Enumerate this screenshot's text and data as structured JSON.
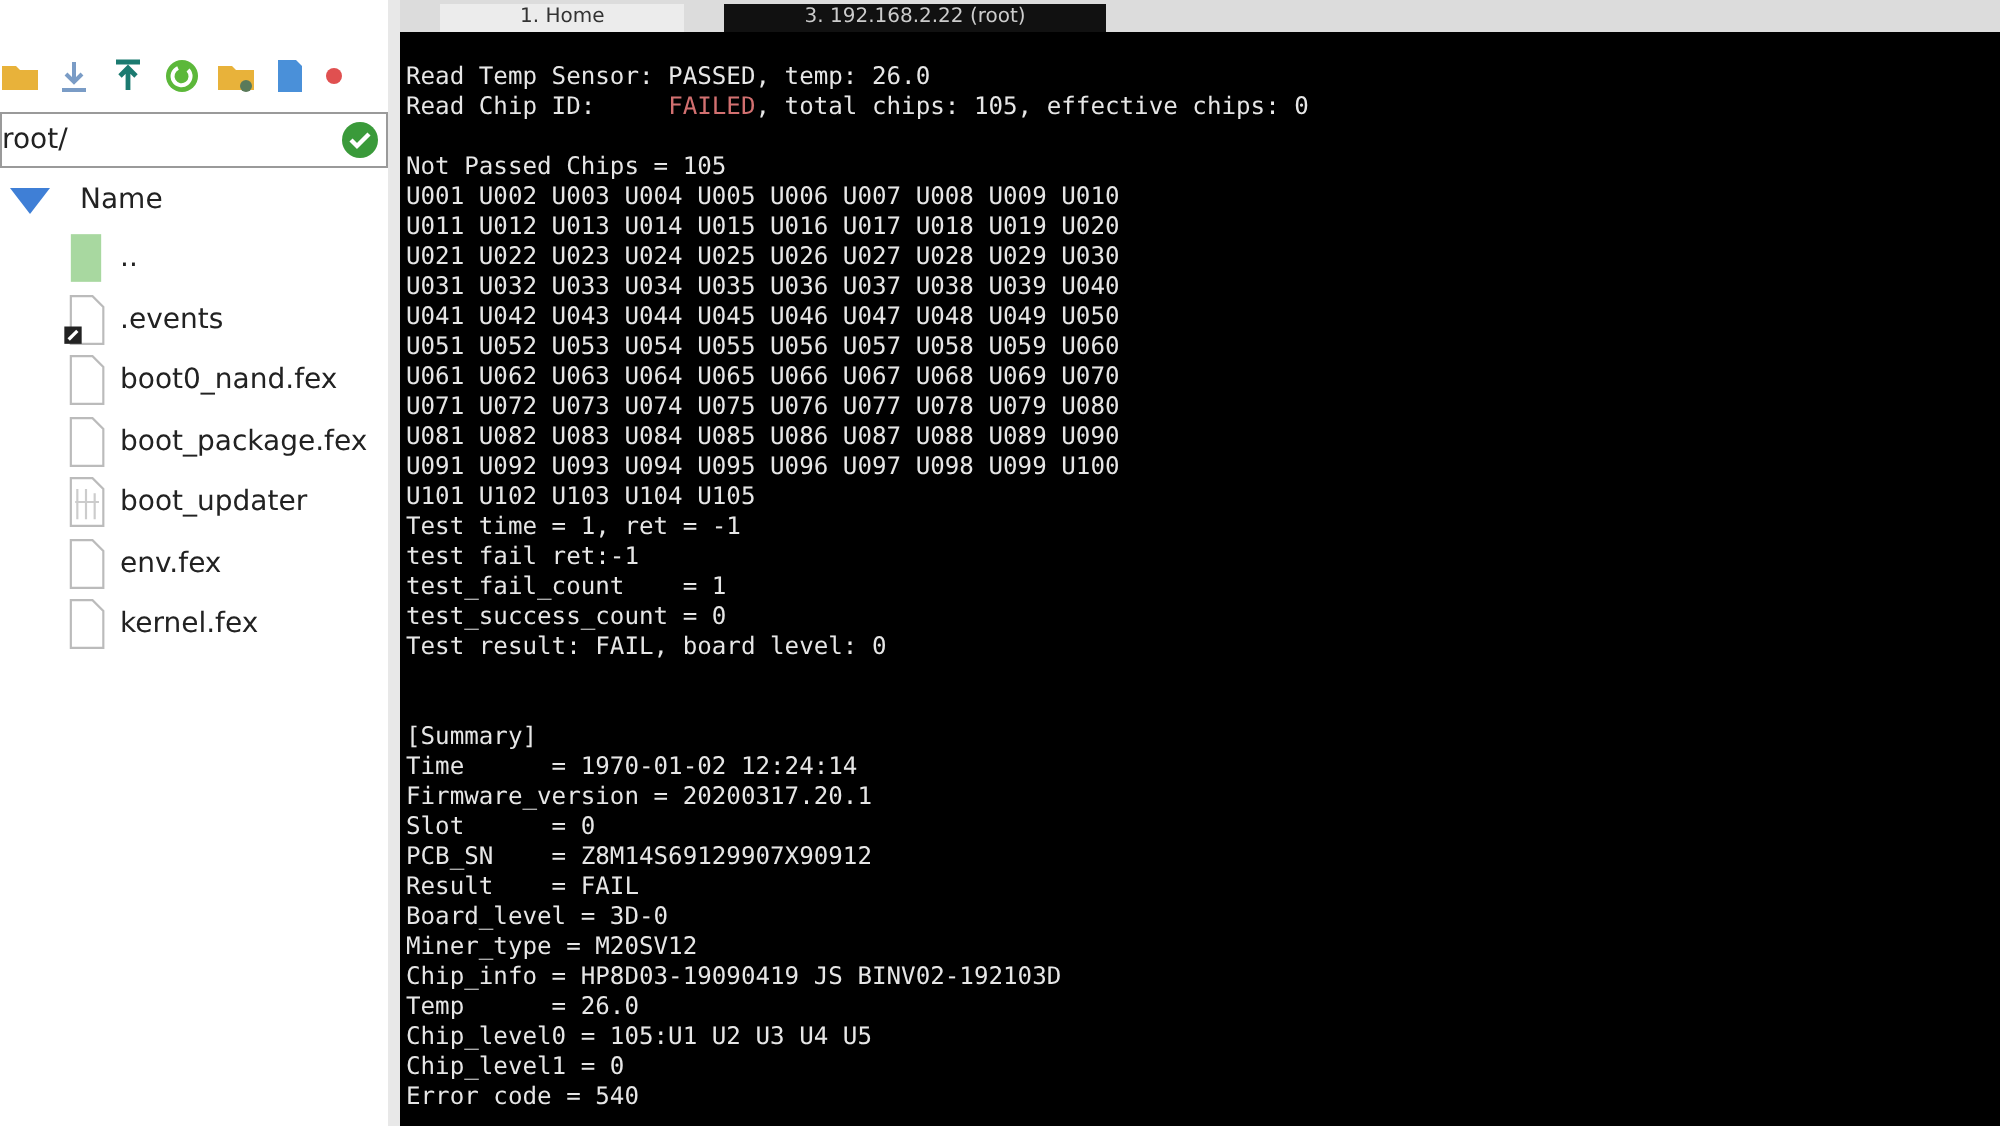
{
  "tabs": [
    {
      "label": "1. Home",
      "selected": false
    },
    {
      "label": "3. 192.168.2.22 (root)",
      "selected": true
    }
  ],
  "file_panel": {
    "path": "root/",
    "column": "Name",
    "files": [
      {
        "name": "..",
        "kind": "parent"
      },
      {
        "name": ".events",
        "kind": "shortcut"
      },
      {
        "name": "boot0_nand.fex",
        "kind": "file"
      },
      {
        "name": "boot_package.fex",
        "kind": "file"
      },
      {
        "name": "boot_updater",
        "kind": "binary"
      },
      {
        "name": "env.fex",
        "kind": "file"
      },
      {
        "name": "kernel.fex",
        "kind": "file"
      }
    ]
  },
  "terminal": {
    "lines": [
      {
        "kind": "blank"
      },
      {
        "kind": "text",
        "text": "Read Temp Sensor: PASSED, temp: 26.0"
      },
      {
        "kind": "status",
        "text": "Read Chip ID:     ",
        "status": "FAILED",
        "rest": ", total chips: 105, effective chips: 0"
      },
      {
        "kind": "blank"
      },
      {
        "kind": "text",
        "text": "Not Passed Chips = 105"
      },
      {
        "kind": "text",
        "text": "U001 U002 U003 U004 U005 U006 U007 U008 U009 U010"
      },
      {
        "kind": "text",
        "text": "U011 U012 U013 U014 U015 U016 U017 U018 U019 U020"
      },
      {
        "kind": "text",
        "text": "U021 U022 U023 U024 U025 U026 U027 U028 U029 U030"
      },
      {
        "kind": "text",
        "text": "U031 U032 U033 U034 U035 U036 U037 U038 U039 U040"
      },
      {
        "kind": "text",
        "text": "U041 U042 U043 U044 U045 U046 U047 U048 U049 U050"
      },
      {
        "kind": "text",
        "text": "U051 U052 U053 U054 U055 U056 U057 U058 U059 U060"
      },
      {
        "kind": "text",
        "text": "U061 U062 U063 U064 U065 U066 U067 U068 U069 U070"
      },
      {
        "kind": "text",
        "text": "U071 U072 U073 U074 U075 U076 U077 U078 U079 U080"
      },
      {
        "kind": "text",
        "text": "U081 U082 U083 U084 U085 U086 U087 U088 U089 U090"
      },
      {
        "kind": "text",
        "text": "U091 U092 U093 U094 U095 U096 U097 U098 U099 U100"
      },
      {
        "kind": "text",
        "text": "U101 U102 U103 U104 U105"
      },
      {
        "kind": "text",
        "text": "Test time = 1, ret = -1"
      },
      {
        "kind": "text",
        "text": "test fail ret:-1"
      },
      {
        "kind": "text",
        "text": "test_fail_count    = 1"
      },
      {
        "kind": "text",
        "text": "test_success_count = 0"
      },
      {
        "kind": "text",
        "text": "Test result: FAIL, board level: 0"
      },
      {
        "kind": "blank"
      },
      {
        "kind": "blank"
      },
      {
        "kind": "text",
        "text": "[Summary]"
      },
      {
        "kind": "text",
        "text": "Time      = 1970-01-02 12:24:14"
      },
      {
        "kind": "text",
        "text": "Firmware_version = 20200317.20.1"
      },
      {
        "kind": "text",
        "text": "Slot      = 0"
      },
      {
        "kind": "text",
        "text": "PCB_SN    = Z8M14S69129907X90912"
      },
      {
        "kind": "text",
        "text": "Result    = FAIL"
      },
      {
        "kind": "text",
        "text": "Board_level = 3D-0"
      },
      {
        "kind": "text",
        "text": "Miner_type = M20SV12"
      },
      {
        "kind": "text",
        "text": "Chip_info = HP8D03-19090419 JS BINV02-192103D"
      },
      {
        "kind": "text",
        "text": "Temp      = 26.0"
      },
      {
        "kind": "text",
        "text": "Chip_level0 = 105:U1 U2 U3 U4 U5"
      },
      {
        "kind": "text",
        "text": "Chip_level1 = 0"
      },
      {
        "kind": "text",
        "text": "Error code = 540"
      }
    ]
  }
}
